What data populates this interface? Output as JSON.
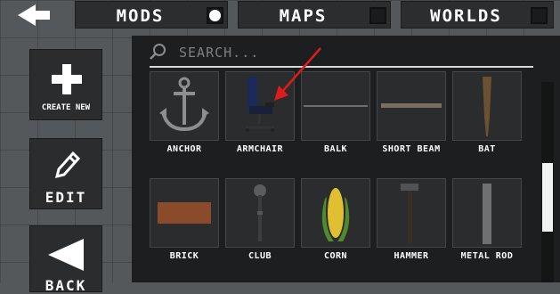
{
  "tabs": [
    {
      "label": "MODS",
      "checked": true
    },
    {
      "label": "MAPS",
      "checked": false
    },
    {
      "label": "WORLDS",
      "checked": false
    }
  ],
  "sidebar": {
    "create_new_label": "CREATE NEW",
    "edit_label": "EDIT",
    "back_label": "BACK"
  },
  "search": {
    "placeholder": "SEARCH..."
  },
  "items": [
    {
      "label": "ANCHOR"
    },
    {
      "label": "ARMCHAIR"
    },
    {
      "label": "BALK"
    },
    {
      "label": "SHORT BEAM"
    },
    {
      "label": "BAT"
    },
    {
      "label": "BRICK"
    },
    {
      "label": "CLUB"
    },
    {
      "label": "CORN"
    },
    {
      "label": "HAMMER"
    },
    {
      "label": "METAL ROD"
    }
  ],
  "annotation": {
    "color": "#e01b1b",
    "icon": "red-arrow-icon"
  },
  "colors": {
    "panel": "#1d1e1f",
    "tile": "#2a2c2e",
    "background": "#55585a",
    "accent": "#ffffff"
  }
}
